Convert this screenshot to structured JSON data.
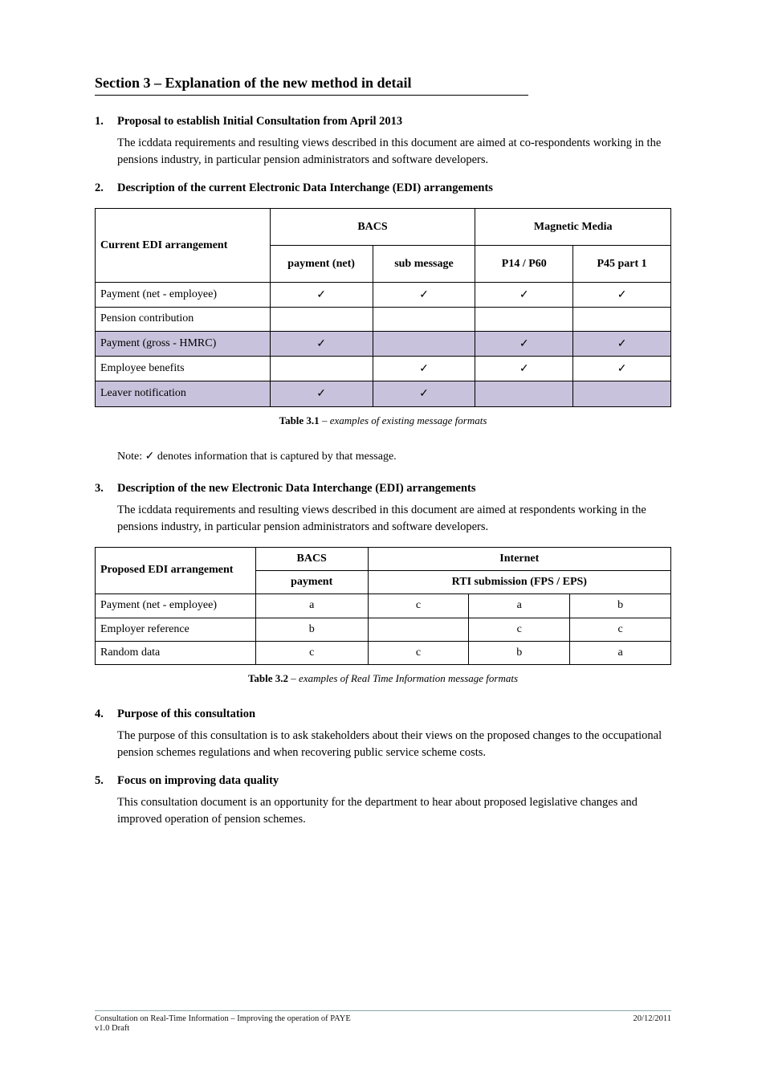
{
  "heading": "Section 3 – Explanation of the new method in detail",
  "sec1": {
    "num": "1.",
    "title": "Proposal to establish Initial Consultation from April 2013",
    "body": "The icddata requirements and resulting views described in this document are aimed at co-respondents working in the pensions industry, in particular pension administrators and software developers."
  },
  "sec2": {
    "num": "2.",
    "title": "Description of the current Electronic Data Interchange (EDI) arrangements"
  },
  "tick": "✓",
  "t1": {
    "h_item": "Current EDI arrangement",
    "h_bacs": "BACS",
    "h_magmedia": "Magnetic Media",
    "h_paymentnet": "payment (net)",
    "h_sub": "sub message",
    "h_p14": "P14 / P60",
    "h_p45": "P45 part 1",
    "rows": [
      {
        "label": "Payment (net - employee)",
        "bacs_pay": "tick",
        "bacs_sub": "tick",
        "mm_p14": "tick",
        "mm_p45": "tick",
        "shade": false
      },
      {
        "label": "Pension contribution",
        "bacs_pay": "",
        "bacs_sub": "",
        "mm_p14": "",
        "mm_p45": "",
        "shade": false
      },
      {
        "label": "Payment (gross - HMRC)",
        "bacs_pay": "tick",
        "bacs_sub": "",
        "mm_p14": "tick",
        "mm_p45": "tick",
        "shade": true
      },
      {
        "label": "Employee benefits",
        "bacs_pay": "",
        "bacs_sub": "tick",
        "mm_p14": "tick",
        "mm_p45": "tick",
        "shade": false
      },
      {
        "label": "Leaver notification",
        "bacs_pay": "tick",
        "bacs_sub": "tick",
        "mm_p14": "",
        "mm_p45": "",
        "shade": true
      }
    ],
    "caption_lab": "Table 3.1",
    "caption_txt": " – examples of existing message formats"
  },
  "note": {
    "lead": "Note:",
    "tick_pre": " ",
    "body": " denotes information that is captured by that message."
  },
  "sec3": {
    "num": "3.",
    "title": "Description of the new Electronic Data Interchange (EDI) arrangements",
    "body": "The icddata requirements and resulting views described in this document are aimed at respondents working in the pensions industry, in particular pension administrators and software developers."
  },
  "t2": {
    "h_item": "Proposed EDI arrangement",
    "h_bacs": "BACS",
    "h_payment": "payment",
    "h_internet": "Internet",
    "h_rti": "RTI submission (FPS / EPS)",
    "caption_lab": "Table 3.2",
    "caption_txt": " – examples of Real Time Information message formats",
    "rows": [
      {
        "label": "Payment (net - employee)",
        "bacs": "a",
        "c1": "c",
        "c2": "a",
        "c3": "b"
      },
      {
        "label": "Employer reference",
        "bacs": "b",
        "c1": "",
        "c2": "c",
        "c3": "c"
      },
      {
        "label": "Random data",
        "bacs": "c",
        "c1": "c",
        "c2": "b",
        "c3": "a"
      }
    ]
  },
  "sec4": {
    "num": "4.",
    "title": "Purpose of this consultation",
    "body": "The purpose of this consultation is to ask stakeholders about their views on the proposed changes to the occupational pension schemes regulations and when recovering public service scheme costs."
  },
  "sec5": {
    "num": "5.",
    "title": "Focus on improving data quality",
    "body": "This consultation document is an opportunity for the department to hear about proposed legislative changes and improved operation of pension schemes."
  },
  "footer": {
    "left1": "Consultation on Real-Time Information – Improving the operation of PAYE",
    "right1": "20/12/2011",
    "left2": "v1.0 Draft"
  }
}
